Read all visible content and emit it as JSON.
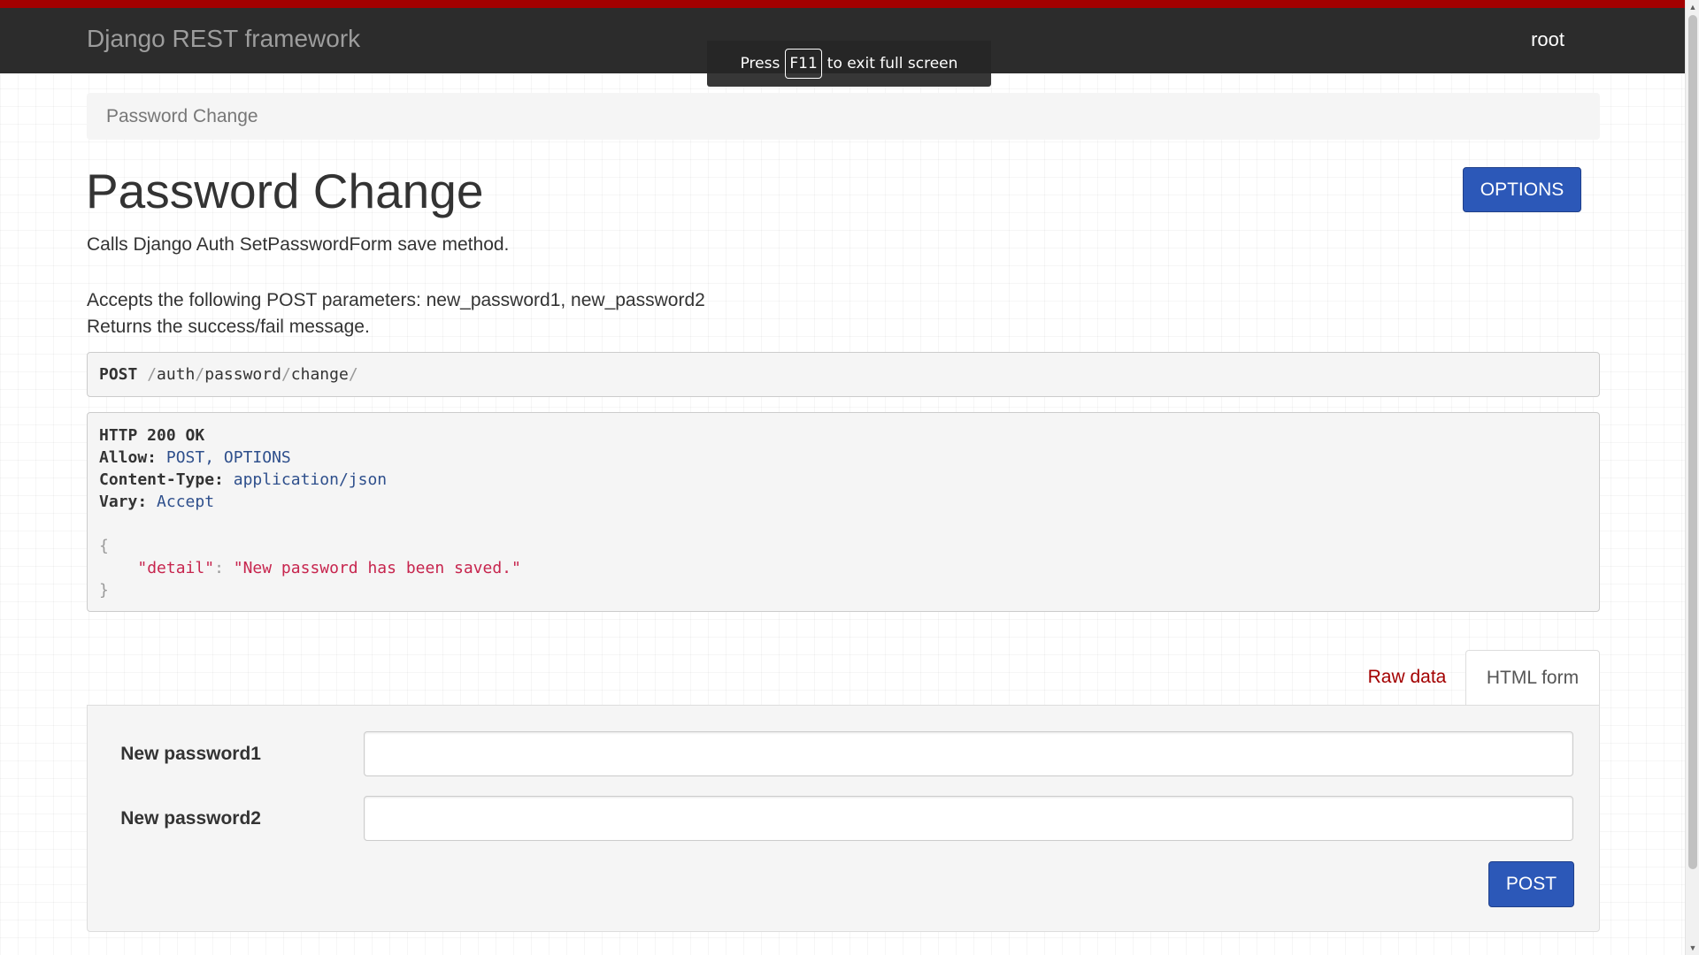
{
  "navbar": {
    "brand": "Django REST framework",
    "user": "root"
  },
  "fullscreen_notice": {
    "prefix": "Press",
    "key": "F11",
    "suffix": "to exit full screen"
  },
  "breadcrumb": {
    "items": [
      "Password Change"
    ]
  },
  "page": {
    "title": "Password Change",
    "options_label": "OPTIONS",
    "description_1": "Calls Django Auth SetPasswordForm save method.",
    "description_2": "Accepts the following POST parameters: new_password1, new_password2",
    "description_3": "Returns the success/fail message."
  },
  "request": {
    "method": "POST",
    "path_parts": [
      "auth",
      "password",
      "change"
    ]
  },
  "response": {
    "status": "HTTP 200 OK",
    "headers": [
      {
        "name": "Allow:",
        "value": "POST, OPTIONS"
      },
      {
        "name": "Content-Type:",
        "value": "application/json"
      },
      {
        "name": "Vary:",
        "value": "Accept"
      }
    ],
    "body_key": "\"detail\"",
    "body_value": "\"New password has been saved.\""
  },
  "tabs": {
    "raw_data": "Raw data",
    "html_form": "HTML form",
    "active": "html_form"
  },
  "form": {
    "field1_label": "New password1",
    "field1_value": "",
    "field2_label": "New password2",
    "field2_value": "",
    "submit_label": "POST"
  },
  "colors": {
    "navbar_bg": "#2c2c2c",
    "navbar_accent": "#a30000",
    "button_blue": "#2c58b8",
    "link_red": "#a30000",
    "json_string": "#c7254e",
    "header_value": "#2e4f8c"
  }
}
